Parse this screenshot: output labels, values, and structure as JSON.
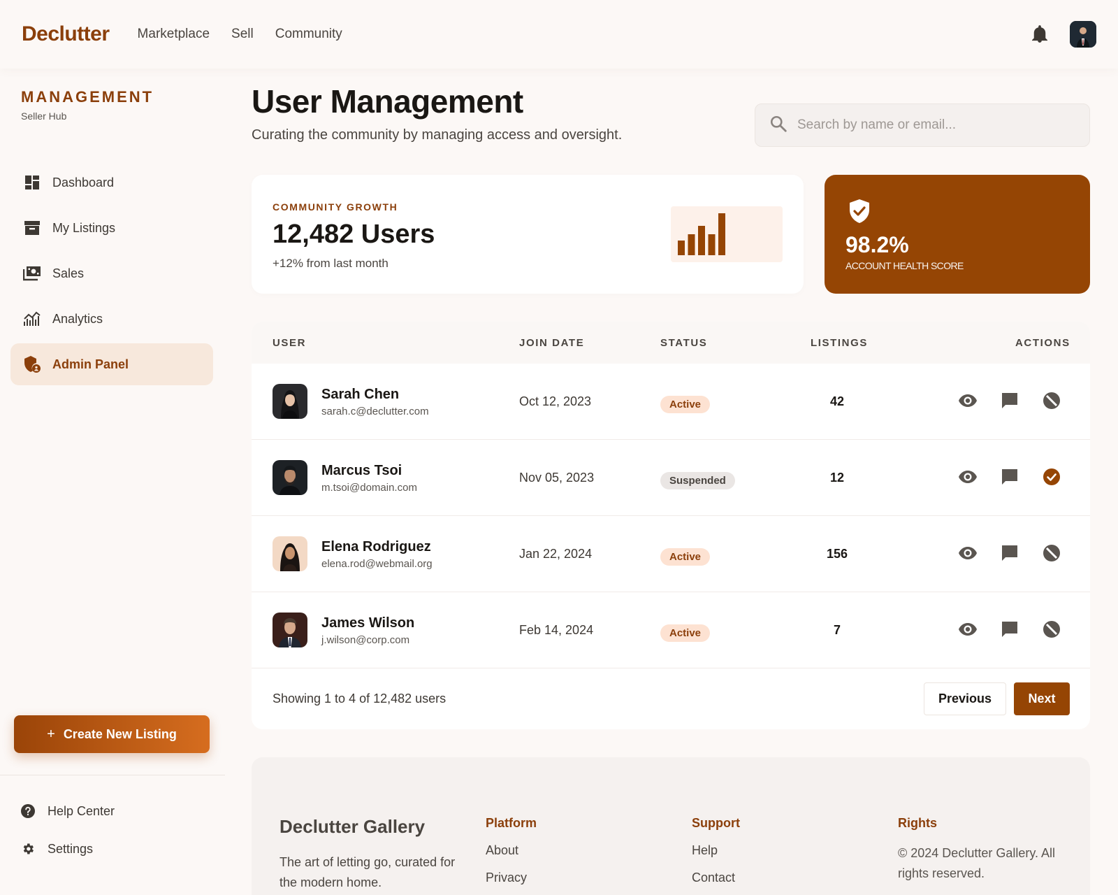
{
  "nav": {
    "brand": "Declutter",
    "links": [
      "Marketplace",
      "Sell",
      "Community"
    ],
    "icons": {
      "notifications": "bell-icon",
      "profile": "avatar"
    }
  },
  "sidebar": {
    "title": "MANAGEMENT",
    "subtitle": "Seller Hub",
    "items": [
      {
        "label": "Dashboard",
        "icon": "dashboard-icon"
      },
      {
        "label": "My Listings",
        "icon": "archive-box-icon"
      },
      {
        "label": "Sales",
        "icon": "payments-icon"
      },
      {
        "label": "Analytics",
        "icon": "analytics-icon"
      },
      {
        "label": "Admin Panel",
        "icon": "admin-shield-icon",
        "active": true
      }
    ],
    "cta": {
      "plus": "+",
      "label": "Create New Listing"
    },
    "bottom": [
      {
        "label": "Help Center",
        "icon": "help-icon"
      },
      {
        "label": "Settings",
        "icon": "gear-icon"
      }
    ]
  },
  "main": {
    "title": "User Management",
    "subtitle": "Curating the community by managing access and oversight.",
    "search": {
      "placeholder": "Search by name or email...",
      "value": ""
    }
  },
  "growth_card": {
    "label": "COMMUNITY GROWTH",
    "value": "12,482 Users",
    "delta": "+12% from last month",
    "sparkline_levels": [
      0.35,
      0.5,
      0.7,
      0.5,
      1.0
    ]
  },
  "health_card": {
    "value": "98.2%",
    "label": "ACCOUNT HEALTH SCORE",
    "icon": "verified-shield-icon"
  },
  "table": {
    "headers": {
      "user": "USER",
      "join_date": "JOIN DATE",
      "status": "STATUS",
      "listings": "LISTINGS",
      "actions": "ACTIONS"
    },
    "rows": [
      {
        "name": "Sarah Chen",
        "email": "sarah.c@declutter.com",
        "join_date": "Oct 12, 2023",
        "status": "Active",
        "listings": "42",
        "state_action": "block-icon"
      },
      {
        "name": "Marcus Tsoi",
        "email": "m.tsoi@domain.com",
        "join_date": "Nov 05, 2023",
        "status": "Suspended",
        "listings": "12",
        "state_action": "check-circle-icon"
      },
      {
        "name": "Elena Rodriguez",
        "email": "elena.rod@webmail.org",
        "join_date": "Jan 22, 2024",
        "status": "Active",
        "listings": "156",
        "state_action": "block-icon"
      },
      {
        "name": "James Wilson",
        "email": "j.wilson@corp.com",
        "join_date": "Feb 14, 2024",
        "status": "Active",
        "listings": "7",
        "state_action": "block-icon"
      }
    ],
    "showing": "Showing 1 to 4 of 12,482 users",
    "prev_label": "Previous",
    "next_label": "Next"
  },
  "footer": {
    "brand": "Declutter Gallery",
    "tagline": "The art of letting go, curated for the modern home.",
    "platform": {
      "heading": "Platform",
      "links": [
        "About",
        "Privacy"
      ]
    },
    "support": {
      "heading": "Support",
      "links": [
        "Help",
        "Contact"
      ]
    },
    "rights": {
      "heading": "Rights",
      "text": "© 2024 Declutter Gallery. All rights reserved."
    }
  },
  "colors": {
    "brand": "#8b3f0b",
    "accent_dark": "#954504",
    "active_bg": "#fde2d2",
    "suspended_bg": "#eae6e4"
  }
}
